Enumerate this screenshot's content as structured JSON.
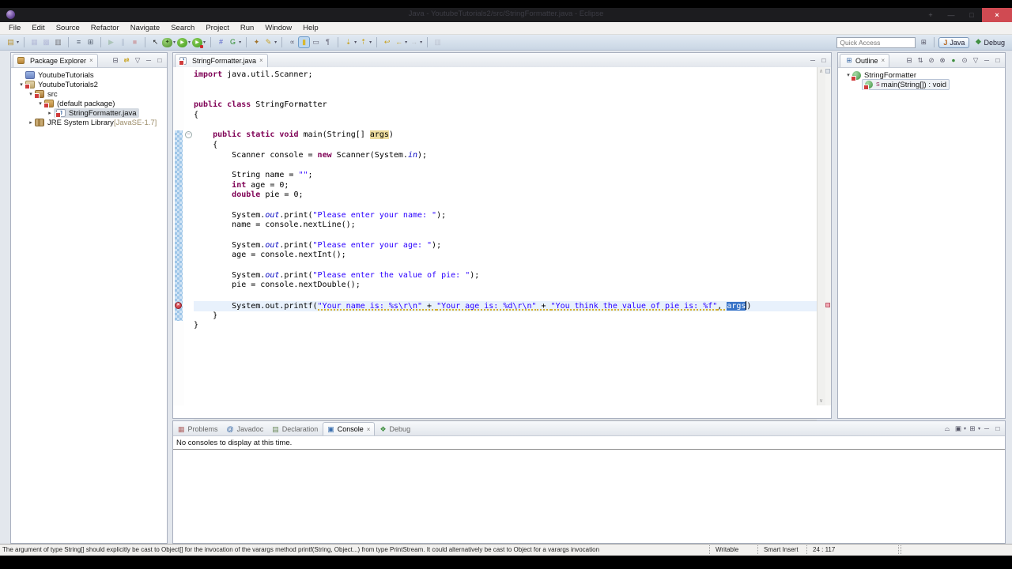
{
  "titlebar": {
    "title": "Java - YoutubeTutorials2/src/StringFormatter.java - Eclipse",
    "window_buttons": [
      {
        "name": "window-extra",
        "glyph": "+"
      },
      {
        "name": "minimize",
        "glyph": "—"
      },
      {
        "name": "maximize",
        "glyph": "□"
      },
      {
        "name": "close",
        "glyph": "×"
      }
    ]
  },
  "menubar": {
    "items": [
      "File",
      "Edit",
      "Source",
      "Refactor",
      "Navigate",
      "Search",
      "Project",
      "Run",
      "Window",
      "Help"
    ]
  },
  "toolbar": {
    "quick_access_placeholder": "Quick Access",
    "groups": [
      [
        {
          "name": "new-wizard",
          "glyph": "▤",
          "color": "#b8912f",
          "dropdown": true
        }
      ],
      [
        {
          "name": "save",
          "glyph": "▦",
          "color": "#8585bb",
          "disabled": true
        },
        {
          "name": "save-all",
          "glyph": "▩",
          "color": "#8585bb",
          "disabled": true
        },
        {
          "name": "print",
          "glyph": "▥",
          "color": "#75757a"
        }
      ],
      [
        {
          "name": "open-task",
          "glyph": "≡",
          "color": "#556070"
        },
        {
          "name": "build-all",
          "glyph": "⊞",
          "color": "#556070"
        }
      ],
      [
        {
          "name": "resume",
          "glyph": "▶",
          "color": "#6a9a6a",
          "disabled": true
        },
        {
          "name": "suspend",
          "glyph": "∥",
          "color": "#6a7a9a",
          "disabled": true
        },
        {
          "name": "terminate",
          "glyph": "■",
          "color": "#c05050",
          "disabled": true
        }
      ],
      [
        {
          "name": "selection-cursor",
          "glyph": "↖",
          "color": "#222"
        },
        {
          "name": "debug-bug",
          "glyph": "✦",
          "dropdown": true
        },
        {
          "name": "run",
          "glyph": "▶",
          "dropdown": true
        },
        {
          "name": "run-external",
          "glyph": "▶",
          "dropdown": true
        }
      ],
      [
        {
          "name": "toggle-breakpoints",
          "glyph": "#",
          "color": "#5560c8"
        },
        {
          "name": "coverage",
          "glyph": "G",
          "color": "#2e8b2e",
          "dropdown": true
        }
      ],
      [
        {
          "name": "new-java-element",
          "glyph": "✦",
          "color": "#a0722a"
        },
        {
          "name": "java-search",
          "glyph": "✎",
          "color": "#c8a020",
          "dropdown": true
        }
      ],
      [
        {
          "name": "externalize-strings",
          "glyph": "∝",
          "color": "#667"
        },
        {
          "name": "mark-occurrences",
          "glyph": "▮",
          "color": "#d8b830",
          "active": true
        },
        {
          "name": "show-selected-element",
          "glyph": "▭",
          "color": "#667"
        },
        {
          "name": "show-whitespace",
          "glyph": "¶",
          "color": "#667"
        }
      ],
      [
        {
          "name": "next-annotation",
          "glyph": "⇣",
          "color": "#c8a018",
          "dropdown": true
        },
        {
          "name": "previous-annotation",
          "glyph": "⇡",
          "color": "#c8a018",
          "dropdown": true
        }
      ],
      [
        {
          "name": "last-edit-location",
          "glyph": "↩",
          "color": "#c8a018"
        },
        {
          "name": "back-history",
          "glyph": "←",
          "color": "#c8a018",
          "dropdown": true
        },
        {
          "name": "forward-history",
          "glyph": "→",
          "color": "#8a8a8a",
          "dropdown": true,
          "disabled": true
        }
      ],
      [
        {
          "name": "open-element",
          "glyph": "▥",
          "color": "#99a",
          "disabled": true
        }
      ]
    ],
    "perspective_bar": {
      "open_perspective_glyph": "⊞",
      "buttons": [
        {
          "name": "java",
          "label": "Java",
          "active": true,
          "icon_glyph": "J",
          "icon_color": "#b5651d"
        },
        {
          "name": "debug",
          "label": "Debug",
          "active": false,
          "icon_glyph": "❖",
          "icon_color": "#3e8e3e"
        }
      ]
    }
  },
  "package_explorer": {
    "title": "Package Explorer",
    "toolbar_icons": [
      {
        "name": "collapse-all",
        "glyph": "⊟"
      },
      {
        "name": "link-with-editor",
        "glyph": "⇄",
        "color": "#c8a018"
      },
      {
        "name": "view-menu",
        "glyph": "▽"
      },
      {
        "name": "minimize",
        "glyph": "─"
      },
      {
        "name": "maximize",
        "glyph": "□"
      }
    ],
    "tree": [
      {
        "label": "YoutubeTutorials",
        "icon": "project-closed",
        "depth": 0,
        "expander": "none"
      },
      {
        "label": "YoutubeTutorials2",
        "icon": "java-project",
        "error": true,
        "depth": 0,
        "expander": "open"
      },
      {
        "label": "src",
        "icon": "source-folder",
        "error": true,
        "depth": 1,
        "expander": "open"
      },
      {
        "label": "(default package)",
        "icon": "package",
        "error": true,
        "depth": 2,
        "expander": "open"
      },
      {
        "label": "StringFormatter.java",
        "icon": "java-file-error",
        "glyph": "J",
        "error": true,
        "depth": 3,
        "expander": "closed",
        "selected": true
      },
      {
        "label": "JRE System Library",
        "suffix": " [JavaSE-1.7]",
        "icon": "library",
        "depth": 1,
        "expander": "closed"
      }
    ]
  },
  "editor": {
    "tab": {
      "label": "StringFormatter.java",
      "icon": "java-file-error",
      "glyph": "J",
      "closable": true
    },
    "header_icons": [
      {
        "name": "minimize",
        "glyph": "─"
      },
      {
        "name": "maximize",
        "glyph": "□"
      }
    ],
    "range_indicator": {
      "from_line": 7,
      "to_line": 25
    },
    "markers": {
      "error_line": 24,
      "overview_line": 24
    },
    "lines": [
      {
        "tokens": [
          [
            "kw",
            "import"
          ],
          [
            "pl",
            " java.util.Scanner;"
          ]
        ]
      },
      {
        "tokens": []
      },
      {
        "tokens": []
      },
      {
        "tokens": [
          [
            "kw",
            "public"
          ],
          [
            "pl",
            " "
          ],
          [
            "kw",
            "class"
          ],
          [
            "pl",
            " StringFormatter"
          ]
        ]
      },
      {
        "tokens": [
          [
            "pl",
            "{"
          ]
        ]
      },
      {
        "tokens": []
      },
      {
        "fold": true,
        "tokens": [
          [
            "pl",
            "    "
          ],
          [
            "kw",
            "public"
          ],
          [
            "pl",
            " "
          ],
          [
            "kw",
            "static"
          ],
          [
            "pl",
            " "
          ],
          [
            "kw",
            "void"
          ],
          [
            "pl",
            " main(String[] "
          ],
          [
            "occ",
            "args"
          ],
          [
            "pl",
            ")"
          ]
        ]
      },
      {
        "tokens": [
          [
            "pl",
            "    {"
          ]
        ]
      },
      {
        "tokens": [
          [
            "pl",
            "        Scanner console = "
          ],
          [
            "kw",
            "new"
          ],
          [
            "pl",
            " Scanner(System."
          ],
          [
            "fld",
            "in"
          ],
          [
            "pl",
            ");"
          ]
        ]
      },
      {
        "tokens": []
      },
      {
        "tokens": [
          [
            "pl",
            "        String name = "
          ],
          [
            "st",
            "\"\""
          ],
          [
            "pl",
            ";"
          ]
        ]
      },
      {
        "tokens": [
          [
            "pl",
            "        "
          ],
          [
            "kw",
            "int"
          ],
          [
            "pl",
            " age = 0;"
          ]
        ]
      },
      {
        "tokens": [
          [
            "pl",
            "        "
          ],
          [
            "kw",
            "double"
          ],
          [
            "pl",
            " pie = 0;"
          ]
        ]
      },
      {
        "tokens": []
      },
      {
        "tokens": [
          [
            "pl",
            "        System."
          ],
          [
            "fld",
            "out"
          ],
          [
            "pl",
            ".print("
          ],
          [
            "st",
            "\"Please enter your name: \""
          ],
          [
            "pl",
            ");"
          ]
        ]
      },
      {
        "tokens": [
          [
            "pl",
            "        name = console.nextLine();"
          ]
        ]
      },
      {
        "tokens": []
      },
      {
        "tokens": [
          [
            "pl",
            "        System."
          ],
          [
            "fld",
            "out"
          ],
          [
            "pl",
            ".print("
          ],
          [
            "st",
            "\"Please enter your age: \""
          ],
          [
            "pl",
            ");"
          ]
        ]
      },
      {
        "tokens": [
          [
            "pl",
            "        age = console.nextInt();"
          ]
        ]
      },
      {
        "tokens": []
      },
      {
        "tokens": [
          [
            "pl",
            "        System."
          ],
          [
            "fld",
            "out"
          ],
          [
            "pl",
            ".print("
          ],
          [
            "st",
            "\"Please enter the value of pie: \""
          ],
          [
            "pl",
            ");"
          ]
        ]
      },
      {
        "tokens": [
          [
            "pl",
            "        pie = console.nextDouble();"
          ]
        ]
      },
      {
        "tokens": []
      },
      {
        "current": true,
        "tokens": [
          [
            "pl",
            "        System.out.printf("
          ],
          [
            "stw",
            "\"Your name is: %s\\r\\n\""
          ],
          [
            "plw",
            " + "
          ],
          [
            "stw",
            "\"Your age is: %d\\r\\n\""
          ],
          [
            "plw",
            " + "
          ],
          [
            "stw",
            "\"You think the value of pie is: %f\""
          ],
          [
            "plw",
            ", "
          ],
          [
            "sel",
            "args"
          ],
          [
            "caret",
            ""
          ],
          [
            "pl",
            ")"
          ]
        ]
      },
      {
        "tokens": [
          [
            "pl",
            "    }"
          ]
        ]
      },
      {
        "tokens": [
          [
            "pl",
            "}"
          ]
        ]
      }
    ]
  },
  "outline": {
    "title": "Outline",
    "toolbar_icons": [
      {
        "name": "collapse-all",
        "glyph": "⊟"
      },
      {
        "name": "sort",
        "glyph": "⇅"
      },
      {
        "name": "hide-fields",
        "glyph": "⊘"
      },
      {
        "name": "hide-static-members",
        "glyph": "⊗"
      },
      {
        "name": "hide-non-public",
        "glyph": "●",
        "color": "#3e8e3e"
      },
      {
        "name": "hide-local-types",
        "glyph": "⊙"
      },
      {
        "name": "view-menu",
        "glyph": "▽"
      },
      {
        "name": "minimize",
        "glyph": "─"
      },
      {
        "name": "maximize",
        "glyph": "□"
      }
    ],
    "tree": [
      {
        "label": "StringFormatter",
        "icon": "class-error",
        "error": true,
        "depth": 0,
        "expander": "open"
      },
      {
        "label": "main(String[]) : void",
        "icon": "method-static-error",
        "error": true,
        "static_decoration": "S",
        "depth": 1,
        "expander": "none",
        "selected": true
      }
    ]
  },
  "console_panel": {
    "tabs": [
      {
        "label": "Problems",
        "icon": "problems-icon",
        "glyph": "▦",
        "color": "#b06868"
      },
      {
        "label": "Javadoc",
        "icon": "javadoc-icon",
        "glyph": "@",
        "color": "#3465a4"
      },
      {
        "label": "Declaration",
        "icon": "declaration-icon",
        "glyph": "▤",
        "color": "#6a8a5a"
      },
      {
        "label": "Console",
        "icon": "console-icon",
        "glyph": "▣",
        "color": "#3a6fae",
        "active": true,
        "closable": true
      },
      {
        "label": "Debug",
        "icon": "debug-icon",
        "glyph": "❖",
        "color": "#3e8e3e"
      }
    ],
    "toolbar_icons": [
      {
        "name": "pin-console",
        "glyph": "⌓"
      },
      {
        "name": "display-selected-console",
        "glyph": "▣",
        "dropdown": true
      },
      {
        "name": "open-console",
        "glyph": "⊞",
        "dropdown": true
      },
      {
        "name": "minimize",
        "glyph": "─"
      },
      {
        "name": "maximize",
        "glyph": "□"
      }
    ],
    "message": "No consoles to display at this time."
  },
  "statusbar": {
    "message": "The argument of type String[] should explicitly be cast to Object[] for the invocation of the varargs method printf(String, Object...) from type PrintStream. It could alternatively be cast to Object for a varargs invocation",
    "writable": "Writable",
    "insert_mode": "Smart Insert",
    "cursor_position": "24 : 117"
  }
}
